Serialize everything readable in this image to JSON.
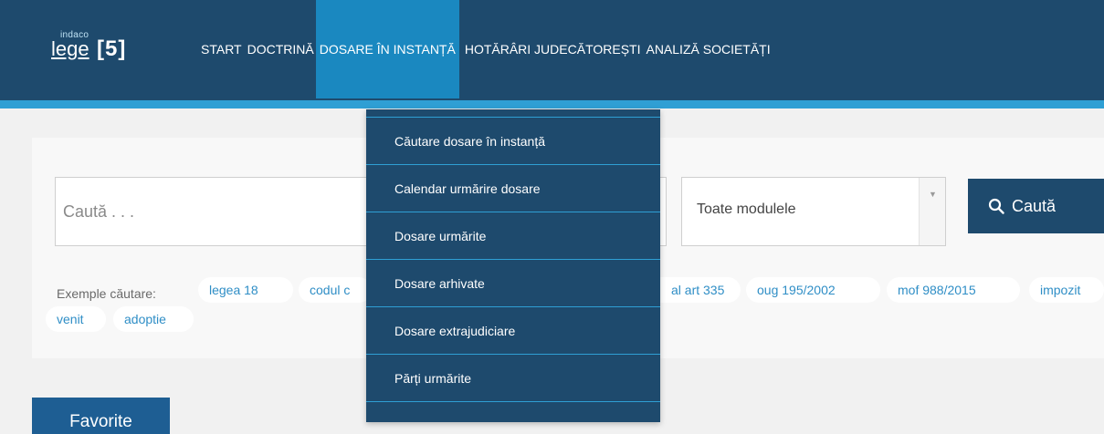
{
  "logo": {
    "brand_small": "indaco",
    "brand_main": "lege",
    "brand_version": "[5]"
  },
  "nav": {
    "items": [
      {
        "label": "START"
      },
      {
        "label": "DOCTRINĂ"
      },
      {
        "label": "DOSARE ÎN INSTANȚĂ"
      },
      {
        "label": "HOTĂRÂRI JUDECĂTOREȘTI"
      },
      {
        "label": "ANALIZĂ SOCIETĂȚI"
      }
    ],
    "active_index": 2
  },
  "search": {
    "placeholder": "Caută . . .",
    "module_select": "Toate modulele",
    "button_label": "Caută"
  },
  "examples": {
    "label": "Exemple căutare:",
    "chips": [
      "legea 18",
      "codul c",
      "al art 335",
      "oug 195/2002",
      "mof 988/2015",
      "impozit",
      "venit",
      "adoptie"
    ]
  },
  "dropdown": {
    "items": [
      "Căutare dosare în instanță",
      "Calendar urmărire dosare",
      "Dosare urmărite",
      "Dosare arhivate",
      "Dosare extrajudiciare",
      "Părți urmărite"
    ]
  },
  "favorites": {
    "label": "Favorite"
  },
  "colors": {
    "header_bg": "#1e4a6d",
    "accent": "#2f9fd4",
    "active_nav": "#1a88c0",
    "chip_text": "#2f8ec6"
  }
}
